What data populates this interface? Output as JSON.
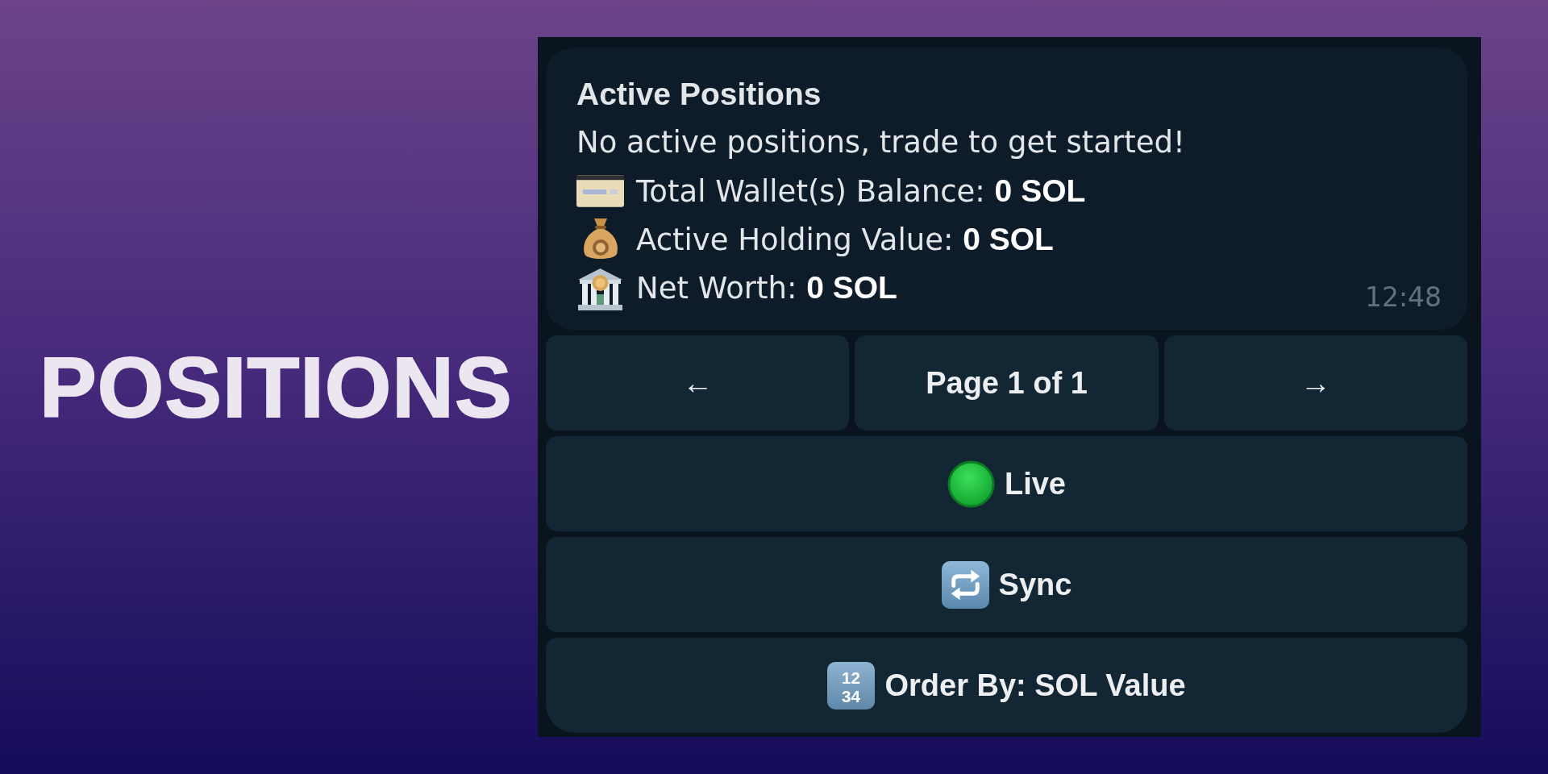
{
  "headline": "POSITIONS",
  "message": {
    "title": "Active Positions",
    "text": "No active positions, trade to get started!",
    "stats": [
      {
        "kind": "balance",
        "text": "Total Wallet(s) Balance: **0 SOL**"
      },
      {
        "kind": "holding",
        "text": "Active Holding Value: **0 SOL**"
      },
      {
        "kind": "worth",
        "text": "Net Worth: **0 SOL**"
      }
    ],
    "time": "12:48"
  },
  "keyboard": [
    {
      "buttons": [
        {
          "kind": "prev",
          "label": "←"
        },
        {
          "kind": "page",
          "label": "Page 1 of 1"
        },
        {
          "kind": "next",
          "label": "→"
        }
      ]
    },
    {
      "buttons": [
        {
          "kind": "live",
          "label": "Live"
        }
      ]
    },
    {
      "buttons": [
        {
          "kind": "sync",
          "label": "Sync"
        }
      ]
    },
    {
      "buttons": [
        {
          "kind": "order",
          "label": "Order By: SOL Value",
          "icon_digits": [
            "12",
            "34"
          ]
        }
      ]
    }
  ]
}
